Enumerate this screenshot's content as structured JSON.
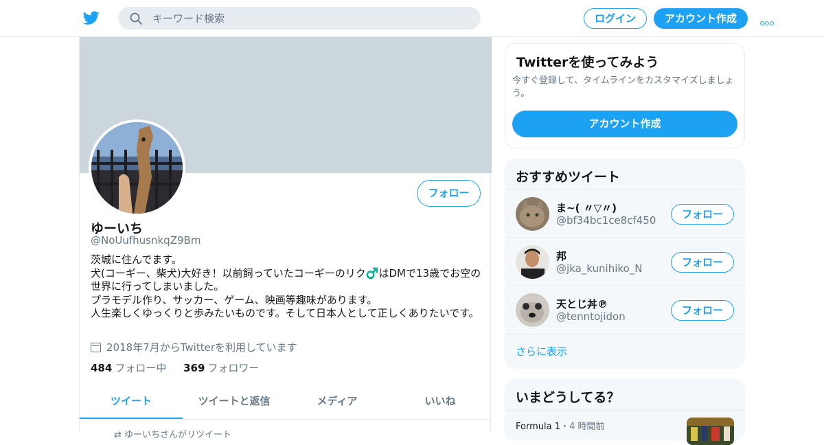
{
  "header": {
    "search_placeholder": "キーワード検索",
    "login_label": "ログイン",
    "signup_label": "アカウント作成",
    "accent_color": "#1da1f2",
    "logo_icon": "twitter-bird-icon",
    "more_icon": "more-dots-icon"
  },
  "profile": {
    "name": "ゆーいち",
    "handle": "@NoUufhusnkqZ9Bm",
    "follow_label": "フォロー",
    "bio": "茨城に住んでます。\n犬(コーギー、柴犬)大好き！以前飼っていたコーギーのリク♂️はDMで13歳でお空の世界に行ってしまいました。\nプラモデル作り、サッカー、ゲーム、映画等趣味があります。\n人生楽しくゆっくりと歩みたいものです。そして日本人として正しくありたいです。",
    "joined": "2018年7月からTwitterを利用しています",
    "following_count": "484",
    "following_label": "フォロー中",
    "followers_count": "369",
    "followers_label": "フォロワー",
    "tabs": [
      {
        "label": "ツイート",
        "active": true
      },
      {
        "label": "ツイートと返信",
        "active": false
      },
      {
        "label": "メディア",
        "active": false
      },
      {
        "label": "いいね",
        "active": false
      }
    ],
    "retweet_note": "ゆーいちさんがリツイート"
  },
  "signup_card": {
    "title": "Twitterを使ってみよう",
    "description": "今すぐ登録して、タイムラインをカスタマイズしましょう。",
    "button_label": "アカウント作成"
  },
  "recommendations": {
    "title": "おすすめツイート",
    "items": [
      {
        "name": "ま~( 〃▽〃)",
        "handle": "@bf34bc1ce8cf450",
        "follow_label": "フォロー"
      },
      {
        "name": "邦",
        "handle": "@jka_kunihiko_N",
        "follow_label": "フォロー"
      },
      {
        "name": "天とじ丼℗",
        "handle": "@tenntojidon",
        "follow_label": "フォロー"
      }
    ],
    "more_label": "さらに表示"
  },
  "trends": {
    "title": "いまどうしてる？",
    "items": [
      {
        "source": "Formula 1",
        "separator": "・",
        "time": "4 時間前"
      }
    ]
  }
}
